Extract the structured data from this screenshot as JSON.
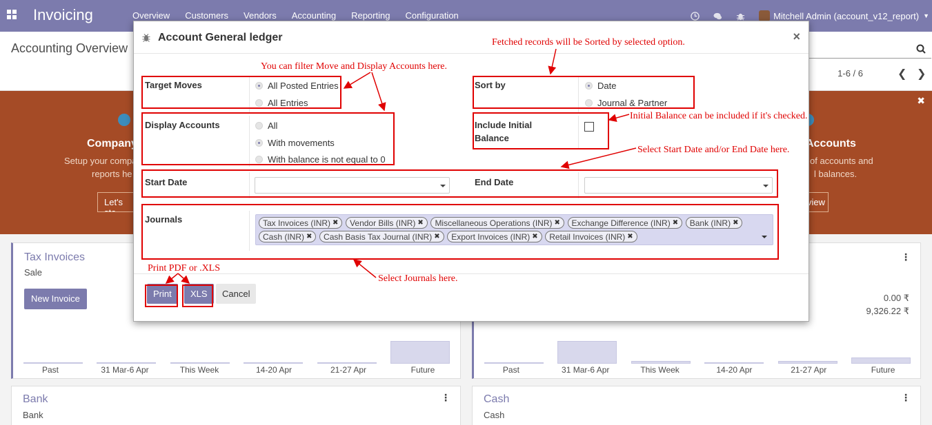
{
  "navbar": {
    "brand": "Invoicing",
    "menu": [
      "Overview",
      "Customers",
      "Vendors",
      "Accounting",
      "Reporting",
      "Configuration"
    ],
    "user": "Mitchell Admin (account_v12_report)",
    "bg_color": "#7c7bad"
  },
  "control_panel": {
    "title": "Accounting Overview",
    "pager": "1-6 / 6"
  },
  "banner": {
    "left_title": "Company",
    "left_text1": "Setup your compa",
    "left_text2": "reports he",
    "left_button": "Let's sta",
    "right_title": "Accounts",
    "right_text1": "of accounts and",
    "right_text2": "l balances.",
    "right_button": "view"
  },
  "cards": {
    "tax_invoices": {
      "title": "Tax Invoices",
      "sub": "Sale",
      "button": "New Invoice",
      "graph_labels": [
        "Past",
        "31 Mar-6 Apr",
        "This Week",
        "14-20 Apr",
        "21-27 Apr",
        "Future"
      ]
    },
    "vendor": {
      "amount1": "0.00 ₹",
      "amount2": "9,326.22 ₹",
      "graph_labels": [
        "Past",
        "31 Mar-6 Apr",
        "This Week",
        "14-20 Apr",
        "21-27 Apr",
        "Future"
      ]
    },
    "bank": {
      "title": "Bank",
      "sub": "Bank"
    },
    "cash": {
      "title": "Cash",
      "sub": "Cash"
    }
  },
  "modal": {
    "title": "Account General ledger",
    "target_moves": {
      "label": "Target Moves",
      "options": [
        "All Posted Entries",
        "All Entries"
      ],
      "selected": "All Posted Entries"
    },
    "display_accounts": {
      "label": "Display Accounts",
      "options": [
        "All",
        "With movements",
        "With balance is not equal to 0"
      ],
      "selected": "With movements"
    },
    "sort_by": {
      "label": "Sort by",
      "options": [
        "Date",
        "Journal & Partner"
      ],
      "selected": "Date"
    },
    "initial_balance": {
      "label_line1": "Include Initial",
      "label_line2": "Balance",
      "checked": false
    },
    "start_date": {
      "label": "Start Date",
      "value": ""
    },
    "end_date": {
      "label": "End Date",
      "value": ""
    },
    "journals": {
      "label": "Journals",
      "tags": [
        "Tax Invoices (INR)",
        "Vendor Bills (INR)",
        "Miscellaneous Operations (INR)",
        "Exchange Difference (INR)",
        "Bank (INR)",
        "Cash (INR)",
        "Cash Basis Tax Journal (INR)",
        "Export Invoices (INR)",
        "Retail Invoices (INR)"
      ]
    },
    "buttons": {
      "print": "Print",
      "xls": "XLS",
      "cancel": "Cancel"
    }
  },
  "annotations": {
    "filter": "You can filter Move and Display Accounts here.",
    "sorted": "Fetched records will be Sorted by selected option.",
    "initial_balance": "Initial Balance can be included if it's checked.",
    "dates": "Select Start Date and/or End Date here.",
    "journals": "Select Journals here.",
    "print": "Print PDF or .XLS",
    "color": "#e00000"
  }
}
